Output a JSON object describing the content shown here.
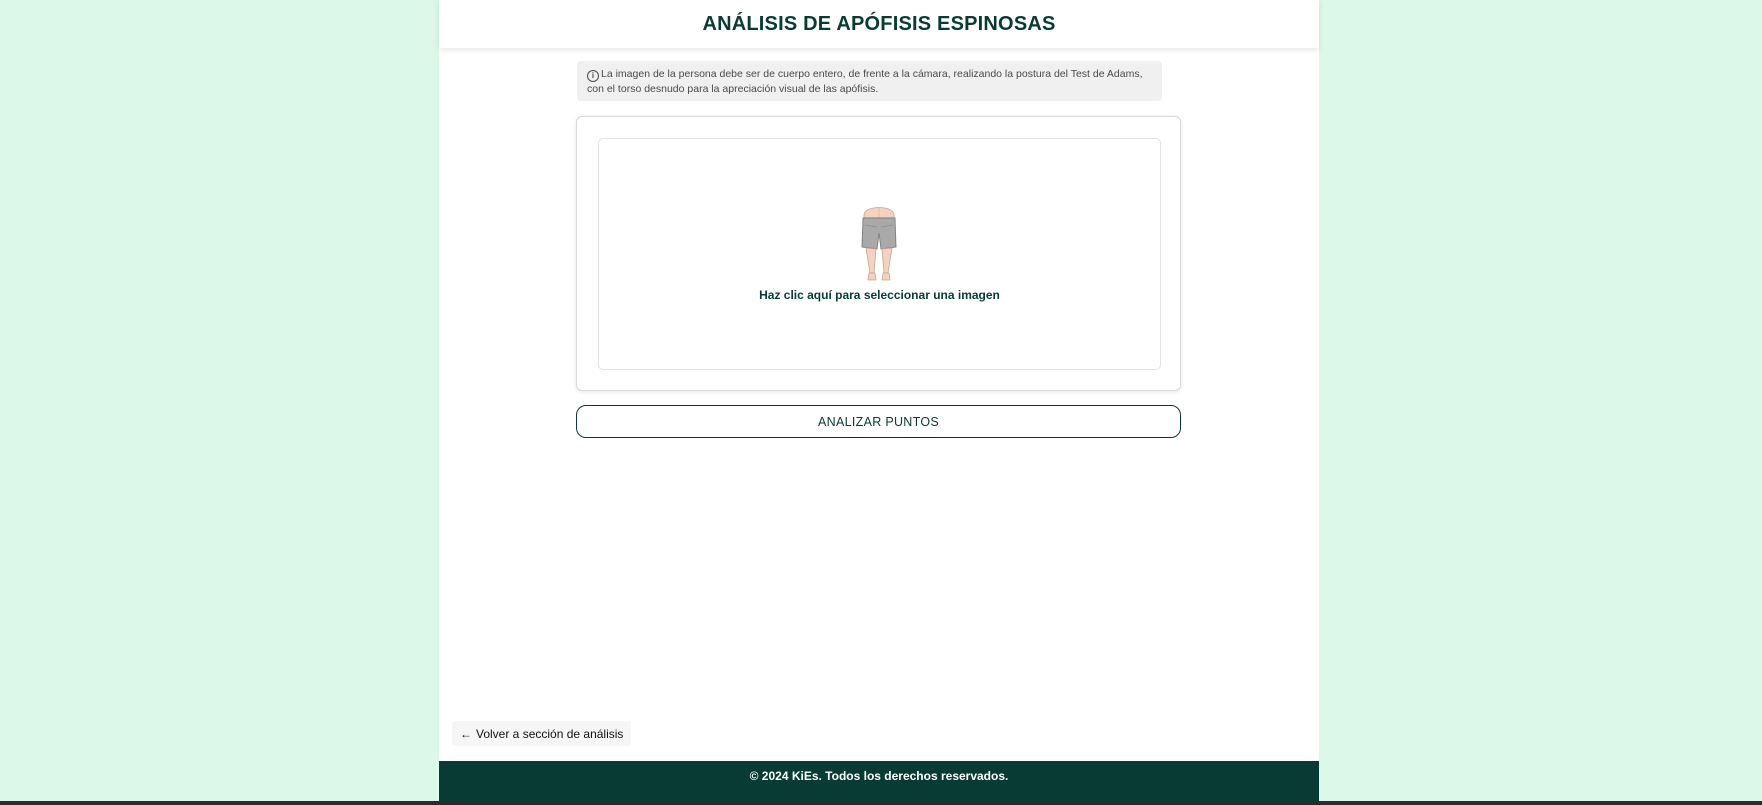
{
  "header": {
    "title": "ANÁLISIS DE APÓFISIS ESPINOSAS"
  },
  "info": {
    "icon": "info-icon",
    "text": "La imagen de la persona debe ser de cuerpo entero, de frente a la cámara, realizando la postura del Test de Adams, con el torso desnudo para la apreciación visual de las apófisis."
  },
  "upload": {
    "icon": "adams-test-figure-icon",
    "label": "Haz clic aquí para seleccionar una imagen"
  },
  "actions": {
    "analyze_label": "ANALIZAR PUNTOS",
    "back_label": "Volver a sección de análisis",
    "back_icon": "arrow-left-icon"
  },
  "footer": {
    "text": "© 2024 KiEs. Todos los derechos reservados."
  },
  "colors": {
    "background": "#dcf8e9",
    "primary": "#073b33",
    "info_bg": "#f0f0f0"
  }
}
